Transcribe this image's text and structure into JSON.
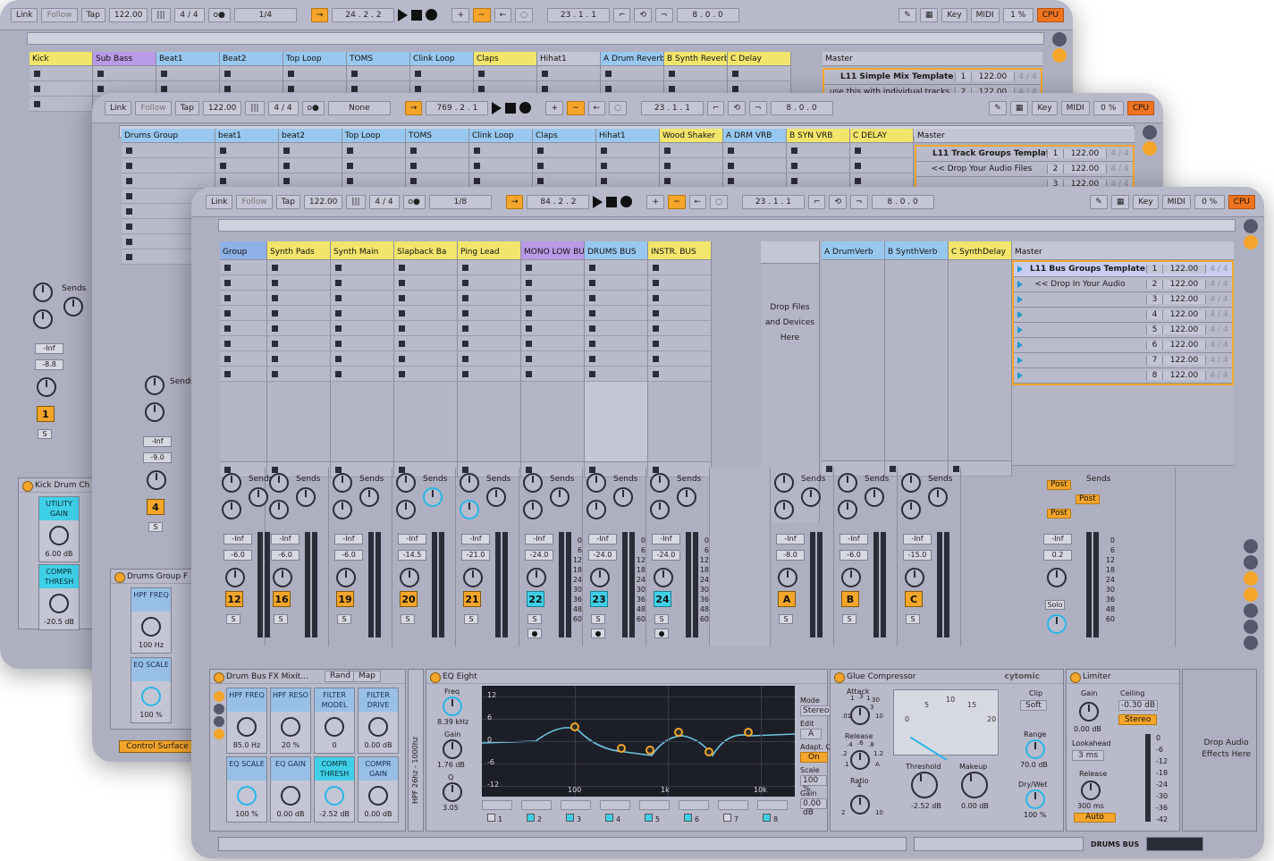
{
  "transport": {
    "link": "Link",
    "follow": "Follow",
    "tap": "Tap",
    "tempo": "122.00",
    "meter_icon": "metronome-bars-icon",
    "signature_num": "4",
    "signature_sep": "/",
    "signature_den": "4",
    "key": "Key",
    "midi": "MIDI",
    "cpu": "CPU"
  },
  "win1": {
    "quantize": "1/4",
    "position": "24 .  2 .  2",
    "loop_start": "23 .  1 .  1",
    "loop_len": "8 .  0 .  0",
    "cpu_pct": "1 %",
    "tracks": [
      "Kick",
      "Sub Bass",
      "Beat1",
      "Beat2",
      "Top Loop",
      "TOMS",
      "Clink Loop",
      "Claps",
      "Hihat1",
      "A Drum Reverb",
      "B Synth Reverb",
      "C Delay",
      "Master"
    ],
    "scenes": [
      {
        "name": "L11 Simple Mix Template",
        "idx": "1",
        "tempo": "122.00",
        "sig": "4 / 4"
      },
      {
        "name": "use this with individual tracks",
        "idx": "2",
        "tempo": "122.00",
        "sig": "4 / 4"
      }
    ],
    "sends": "Sends",
    "vol_a": "-Inf",
    "vol_b": "-8.8",
    "track_num": "1",
    "solo": "S",
    "device_title": "Kick Drum Ch",
    "macro1": "UTILITY GAIN",
    "macro1_val": "6.00 dB",
    "macro2": "COMPR THRESH",
    "macro2_val": "-20.5 dB"
  },
  "win2": {
    "quantize": "None",
    "position": "769 .  2 .  1",
    "loop_start": "23 .  1 .  1",
    "loop_len": "8 .  0 .  0",
    "cpu_pct": "0 %",
    "tracks": [
      "Drums Group",
      "beat1",
      "beat2",
      "Top Loop",
      "TOMS",
      "Clink Loop",
      "Claps",
      "Hihat1",
      "Wood Shaker",
      "A DRM VRB",
      "B SYN VRB",
      "C DELAY",
      "Master"
    ],
    "scenes": [
      {
        "name": "L11 Track Groups Template",
        "idx": "1",
        "tempo": "122.00",
        "sig": "4 / 4"
      },
      {
        "name": "<< Drop Your Audio Files",
        "idx": "2",
        "tempo": "122.00",
        "sig": "4 / 4"
      },
      {
        "name": "",
        "idx": "3",
        "tempo": "122.00",
        "sig": "4 / 4"
      }
    ],
    "sends": "Sends",
    "vol_a": "-Inf",
    "vol_b": "-9.0",
    "track_num": "4",
    "solo": "S",
    "device_title": "Drums Group F",
    "macro1": "HPF FREQ",
    "macro1_val": "100 Hz",
    "macro2": "EQ SCALE",
    "macro2_val": "100 %",
    "control_surface": "Control Surface"
  },
  "win3": {
    "quantize": "1/8",
    "position": "84 .  2 .  2",
    "loop_start": "23 .  1 .  1",
    "loop_len": "8 .  0 .  0",
    "cpu_pct": "0 %",
    "tracks": [
      {
        "name": "Group",
        "color": "#8fb0e6",
        "num": "12",
        "vol": "-6.0",
        "blue": false
      },
      {
        "name": "Synth Pads",
        "color": "#f2e56b",
        "num": "16",
        "vol": "-6.0",
        "blue": false
      },
      {
        "name": "Synth Main",
        "color": "#f2e56b",
        "num": "19",
        "vol": "-6.0",
        "blue": false
      },
      {
        "name": "Slapback Ba",
        "color": "#f2e56b",
        "num": "20",
        "vol": "-14.5",
        "blue": false
      },
      {
        "name": "Ping Lead",
        "color": "#f2e56b",
        "num": "21",
        "vol": "-21.0",
        "blue": false
      },
      {
        "name": "MONO LOW BUS",
        "color": "#b89ae6",
        "num": "22",
        "vol": "-24.0",
        "blue": true
      },
      {
        "name": "DRUMS BUS",
        "color": "#98c8ef",
        "num": "23",
        "vol": "-24.0",
        "blue": true
      },
      {
        "name": "INSTR. BUS",
        "color": "#f2e56b",
        "num": "24",
        "vol": "-24.0",
        "blue": true
      }
    ],
    "drop_zone": [
      "Drop Files",
      "and Devices",
      "Here"
    ],
    "returns": [
      {
        "name": "A DrumVerb",
        "color": "#98c8ef",
        "num": "A",
        "vol": "-8.0"
      },
      {
        "name": "B SynthVerb",
        "color": "#98c8ef",
        "num": "B",
        "vol": "-6.0"
      },
      {
        "name": "C SynthDelay",
        "color": "#f2e56b",
        "num": "C",
        "vol": "-15.0"
      }
    ],
    "master": {
      "name": "Master",
      "vol": "0.2",
      "solo": "Solo",
      "post": "Post"
    },
    "scenes": [
      {
        "name": "L11 Bus Groups Template",
        "idx": "1"
      },
      {
        "name": "<< Drop In Your Audio",
        "idx": "2"
      },
      {
        "name": "",
        "idx": "3"
      },
      {
        "name": "",
        "idx": "4"
      },
      {
        "name": "",
        "idx": "5"
      },
      {
        "name": "",
        "idx": "6"
      },
      {
        "name": "",
        "idx": "7"
      },
      {
        "name": "",
        "idx": "8"
      }
    ],
    "scene_tempo": "122.00",
    "scene_sig": "4 / 4",
    "sends": "Sends",
    "vol_inf": "-Inf",
    "solo": "S",
    "db_scale": [
      "0",
      "6",
      "12",
      "18",
      "24",
      "30",
      "36",
      "48",
      "60"
    ],
    "devices": {
      "rack": {
        "title": "Drum Bus FX Mixit...",
        "rand": "Rand",
        "map": "Map",
        "macros": [
          {
            "label": "HPF FREQ",
            "value": "85.0 Hz",
            "on": false
          },
          {
            "label": "HPF RESO",
            "value": "20 %",
            "on": false
          },
          {
            "label": "FILTER MODEL",
            "value": "0",
            "on": false
          },
          {
            "label": "FILTER DRIVE",
            "value": "0.00 dB",
            "on": false
          },
          {
            "label": "EQ SCALE",
            "value": "100 %",
            "on": false
          },
          {
            "label": "EQ GAIN",
            "value": "0.00 dB",
            "on": false
          },
          {
            "label": "COMPR THRESH",
            "value": "-2.52 dB",
            "on": true
          },
          {
            "label": "COMPR GAIN",
            "value": "0.00 dB",
            "on": false
          }
        ]
      },
      "filter_side": "HPF 26hz - 1000hz",
      "eq": {
        "title": "EQ Eight",
        "freq_label": "Freq",
        "freq": "8.39 kHz",
        "gain_label": "Gain",
        "gain": "1.76 dB",
        "q_label": "Q",
        "q": "3.05",
        "grid_y": [
          "12",
          "6",
          "0",
          "-6",
          "-12"
        ],
        "grid_x": [
          "100",
          "1k",
          "10k"
        ],
        "mode_label": "Mode",
        "mode": "Stereo",
        "edit_label": "Edit",
        "edit": "A",
        "adapt_label": "Adapt. Q",
        "adapt": "On",
        "scale_label": "Scale",
        "scale": "100 %",
        "out_label": "Gain",
        "out": "0.00 dB",
        "bands": [
          "1",
          "2",
          "3",
          "4",
          "5",
          "6",
          "7",
          "8"
        ]
      },
      "glue": {
        "title": "Glue Compressor",
        "brand": "cytomic",
        "attack": "Attack",
        "release": "Release",
        "ratio": "Ratio",
        "clip": "Clip",
        "soft": "Soft",
        "range": "Range",
        "range_val": "70.0 dB",
        "threshold": "Threshold",
        "threshold_val": "-2.52 dB",
        "makeup": "Makeup",
        "makeup_val": "0.00 dB",
        "drywet": "Dry/Wet",
        "drywet_val": "100 %",
        "attack_ticks": [
          ".1",
          ".3",
          "1",
          "3",
          ".01",
          "10",
          "30"
        ],
        "release_ticks": [
          ".4",
          ".6",
          ".8",
          ".2",
          "1.2",
          ".1",
          "A"
        ],
        "ratio_ticks": [
          "4",
          "2",
          "10"
        ],
        "vu_ticks": [
          "0",
          "5",
          "10",
          "15",
          "20"
        ]
      },
      "limiter": {
        "title": "Limiter",
        "gain": "Gain",
        "gain_val": "0.00 dB",
        "ceiling": "Ceiling",
        "ceiling_val": "-0.30 dB",
        "stereo": "Stereo",
        "lookahead": "Lookahead",
        "lookahead_val": "3 ms",
        "release": "Release",
        "release_val": "300 ms",
        "auto": "Auto",
        "scale": [
          "0",
          "-6",
          "-12",
          "-18",
          "-24",
          "-30",
          "-36",
          "-42"
        ]
      },
      "drop_fx": [
        "Drop Audio",
        "Effects Here"
      ]
    },
    "status_track": "DRUMS BUS"
  },
  "colors": {
    "orange": "#f4a52a",
    "cyan": "#3fd0e8",
    "blue_clip": "#98c0e6",
    "selection": "#f4a52a"
  }
}
